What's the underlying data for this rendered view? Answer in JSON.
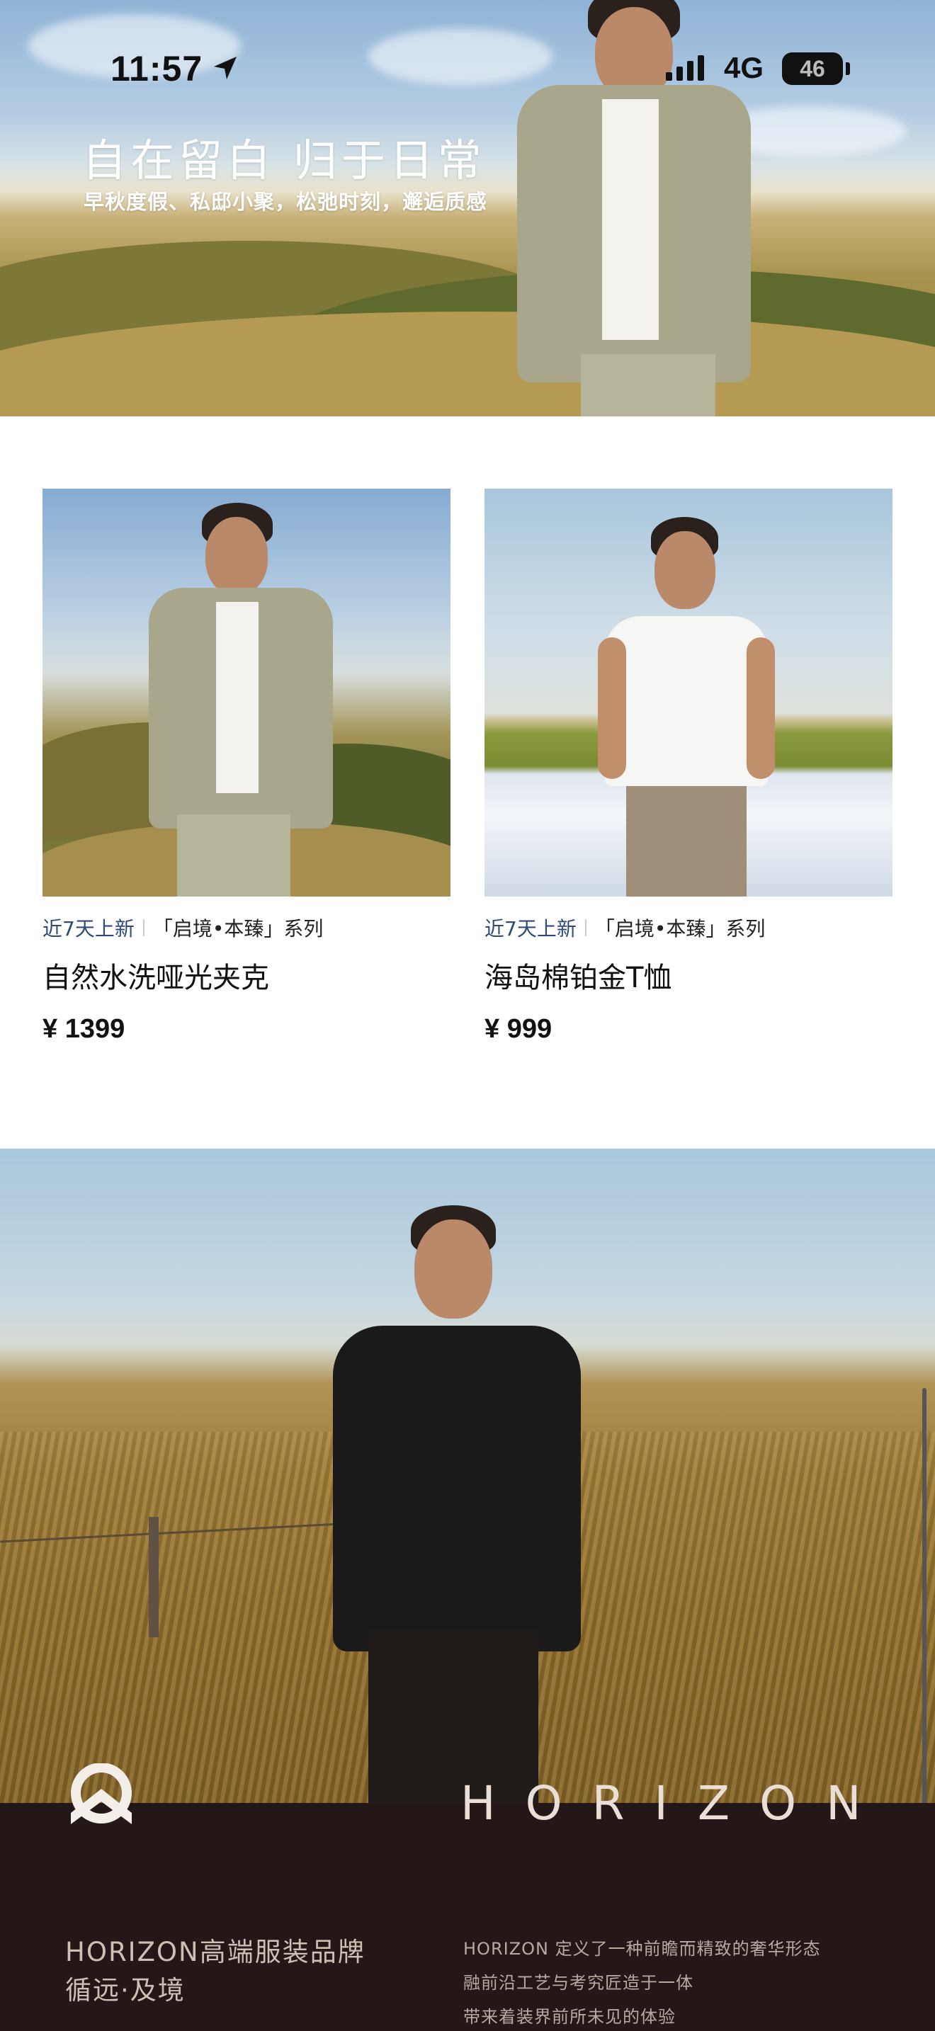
{
  "status_bar": {
    "time": "11:57",
    "network": "4G",
    "battery": "46",
    "icons": [
      "location-arrow-icon",
      "signal-bars-icon",
      "battery-icon"
    ]
  },
  "hero": {
    "title": "自在留白 归于日常",
    "subtitle": "早秋度假、私邸小聚，松弛时刻，邂逅质感"
  },
  "products": [
    {
      "tag_new": "近7天上新",
      "series": "「启境•本臻」系列",
      "name": "自然水洗哑光夹克",
      "price": "¥ 1399"
    },
    {
      "tag_new": "近7天上新",
      "series": "「启境•本臻」系列",
      "name": "海岛棉铂金T恤",
      "price": "¥ 999"
    }
  ],
  "brand": {
    "logo_text": "HORIZON",
    "title": "HORIZON高端服装品牌",
    "subtitle": "循远·及境",
    "description": [
      "HORIZON 定义了一种前瞻而精致的奢华形态",
      "融前沿工艺与考究匠造于一体",
      "带来着装界前所未见的体验"
    ]
  },
  "colors": {
    "accent_new_tag": "#2f4a78",
    "footer_bg": "#241717",
    "footer_text": "#cdbfb4"
  }
}
